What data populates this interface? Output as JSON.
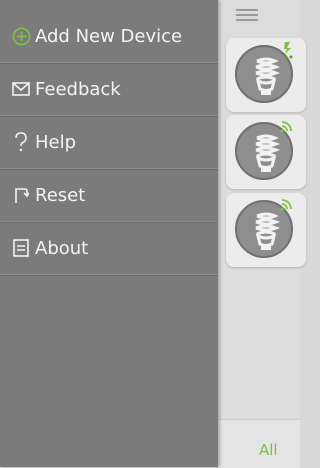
{
  "drawer": {
    "items": [
      {
        "label": "Add New Device",
        "icon": "add-circle-icon"
      },
      {
        "label": "Feedback",
        "icon": "envelope-icon"
      },
      {
        "label": "Help",
        "icon": "question-icon"
      },
      {
        "label": "Reset",
        "icon": "reset-icon"
      },
      {
        "label": "About",
        "icon": "info-document-icon"
      }
    ]
  },
  "footer": {
    "all_label": "All"
  },
  "colors": {
    "accent": "#7cc242",
    "drawer_bg": "#7b7b7b",
    "device_circle": "#8e8e8e"
  },
  "devices": [
    {
      "icon": "bulb-icon",
      "status_icon": "plug-badge-icon"
    },
    {
      "icon": "bulb-icon",
      "status_icon": "wifi-icon"
    },
    {
      "icon": "bulb-icon",
      "status_icon": "wifi-icon"
    }
  ]
}
